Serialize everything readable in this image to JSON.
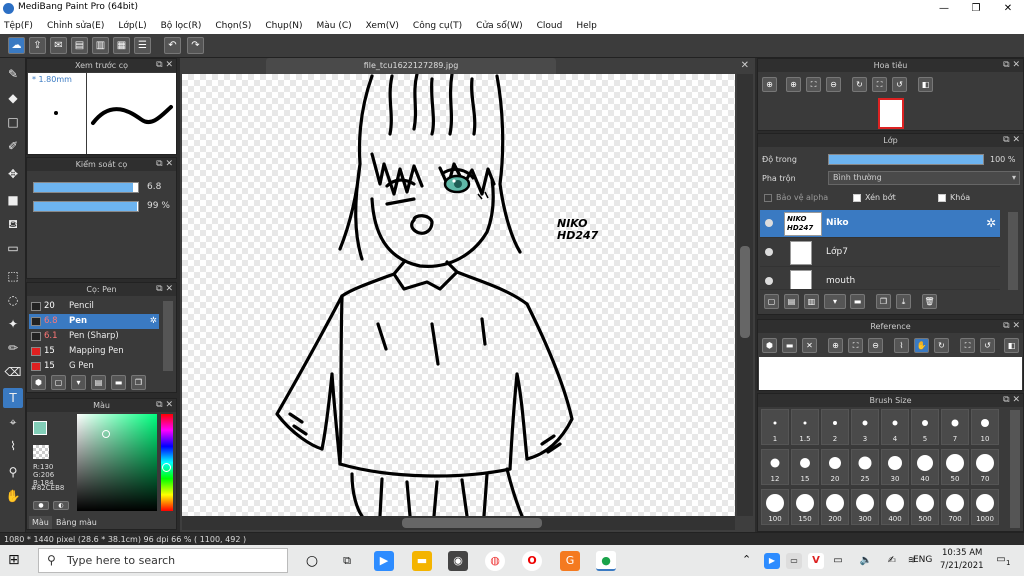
{
  "app": {
    "title": "MediBang Paint Pro (64bit)"
  },
  "window_controls": {
    "minimize": "—",
    "restore": "❐",
    "close": "✕"
  },
  "menu": [
    "Tệp(F)",
    "Chỉnh sửa(E)",
    "Lớp(L)",
    "Bộ lọc(R)",
    "Chọn(S)",
    "Chụp(N)",
    "Màu (C)",
    "Xem(V)",
    "Công cụ(T)",
    "Cửa sổ(W)",
    "Cloud",
    "Help"
  ],
  "document": {
    "tab_title": "file_tcu1622127289.jpg",
    "signature_line1": "NIKO",
    "signature_line2": "HD247"
  },
  "brush_preview": {
    "title": "Xem trước cọ",
    "size": "* 1.80mm"
  },
  "brush_control": {
    "title": "Kiểm soát cọ",
    "size_value": "6.8",
    "size_fill": 0.95,
    "opacity_value": "99 %",
    "opacity_fill": 0.99
  },
  "brush_list": {
    "title": "Cọ: Pen",
    "items": [
      {
        "size": "20",
        "name": "Pencil",
        "color": "#222222",
        "selected": false
      },
      {
        "size": "6.8",
        "name": "Pen",
        "color": "#222222",
        "selected": true
      },
      {
        "size": "6.1",
        "name": "Pen (Sharp)",
        "color": "#222222",
        "selected": false
      },
      {
        "size": "15",
        "name": "Mapping Pen",
        "color": "#e02020",
        "selected": false
      },
      {
        "size": "15",
        "name": "G Pen",
        "color": "#e02020",
        "selected": false
      }
    ]
  },
  "color_panel": {
    "title": "Màu",
    "r": "R:130",
    "g": "G:206",
    "b": "B:184",
    "hex": "#82CEB8",
    "tab_color": "Màu",
    "tab_palette": "Bảng màu",
    "current_color": "#82CEB8"
  },
  "navigator": {
    "title": "Hoa tiêu"
  },
  "layers": {
    "title": "Lớp",
    "opacity_label": "Độ trong",
    "opacity_value": "100 %",
    "opacity_fill": 1.0,
    "blend_label": "Pha trộn",
    "blend_value": "Bình thường",
    "protect_alpha": "Bảo vệ alpha",
    "clipping": "Xén bớt",
    "lock": "Khóa",
    "items": [
      {
        "name": "Niko",
        "selected": true
      },
      {
        "name": "Lớp7",
        "selected": false
      },
      {
        "name": "mouth",
        "selected": false
      }
    ]
  },
  "reference": {
    "title": "Reference"
  },
  "brush_size": {
    "title": "Brush Size",
    "sizes": [
      "1",
      "1.5",
      "2",
      "3",
      "4",
      "5",
      "7",
      "10",
      "12",
      "15",
      "20",
      "25",
      "30",
      "40",
      "50",
      "70",
      "100",
      "150",
      "200",
      "300",
      "400",
      "500",
      "700",
      "1000"
    ]
  },
  "status": {
    "text": "1080 * 1440 pixel   (28.6 * 38.1cm)   96 dpi   66 %   ( 1100, 492 )"
  },
  "taskbar": {
    "search_placeholder": "Type here to search",
    "language": "ENG",
    "time": "10:35 AM",
    "date": "7/21/2021",
    "notification_count": "1"
  }
}
